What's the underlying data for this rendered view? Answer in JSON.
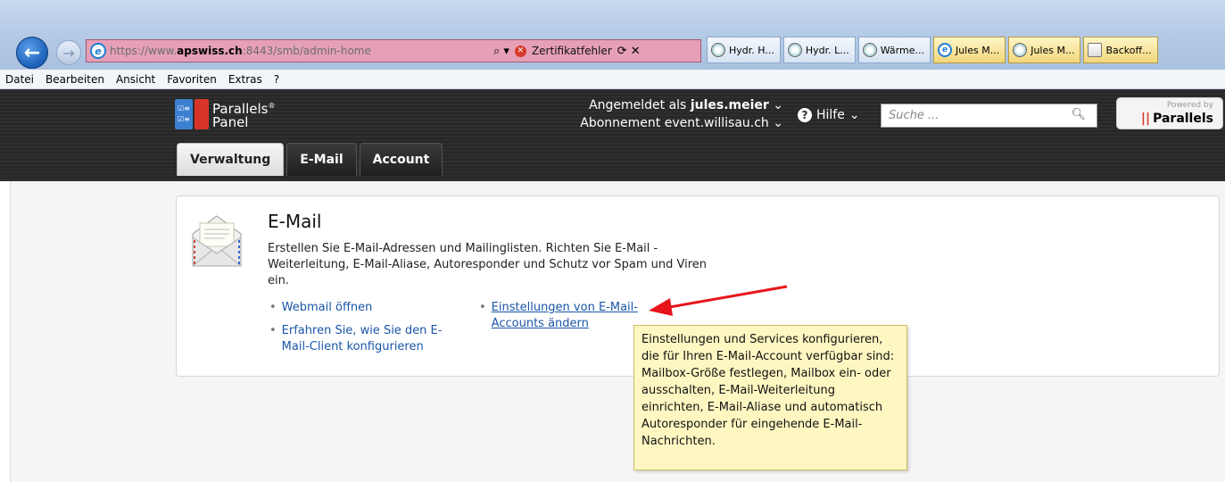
{
  "browser": {
    "url_prefix": "https://www.",
    "url_domain": "apswiss.ch",
    "url_suffix": ":8443/smb/admin-home",
    "search_glyph": "⌕ ▾",
    "cert_error": "Zertifikatfehler",
    "tools_glyph": "⟳ ✕",
    "tabs": [
      {
        "label": "Hydr. H...",
        "icon": "web-icon"
      },
      {
        "label": "Hydr. L...",
        "icon": "web-icon"
      },
      {
        "label": "Wärme...",
        "icon": "web-icon"
      },
      {
        "label": "Jules M...",
        "icon": "ie-icon"
      },
      {
        "label": "Jules M...",
        "icon": "web-icon"
      },
      {
        "label": "Backoff...",
        "icon": "doc-icon"
      }
    ],
    "menu": [
      "Datei",
      "Bearbeiten",
      "Ansicht",
      "Favoriten",
      "Extras",
      "?"
    ]
  },
  "panel": {
    "logo_line1": "Parallels",
    "logo_reg": "®",
    "logo_line2": "Panel",
    "logged_in_label": "Angemeldet als ",
    "user": "jules.meier",
    "subscription_label": "Abonnement ",
    "subscription": "event.willisau.ch",
    "help": "Hilfe",
    "search_placeholder": "Suche ...",
    "powered_by": "Powered by",
    "powered_brand": "Parallels",
    "tabs": [
      "Verwaltung",
      "E-Mail",
      "Account"
    ]
  },
  "email_card": {
    "title": "E-Mail",
    "description": "Erstellen Sie E-Mail-Adressen und Mailinglisten. Richten Sie E-Mail -Weiterleitung, E-Mail-Aliase, Autoresponder und Schutz vor Spam und Viren ein.",
    "link_webmail": "Webmail öffnen",
    "link_client_line1": "Erfahren Sie, wie Sie den E-",
    "link_client_line2": "Mail-Client konfigurieren",
    "link_settings_line1": "Einstellungen von E-Mail-",
    "link_settings_line2": "Accounts ändern",
    "tooltip": "Einstellungen und Services konfigurieren, die für Ihren E-Mail-Account verfügbar sind: Mailbox-Größe festlegen, Mailbox ein- oder ausschalten, E-Mail-Weiterleitung einrichten, E-Mail-Aliase und automatisch Autoresponder für eingehende E-Mail-Nachrichten."
  },
  "colors": {
    "annotation_arrow": "#e8141b",
    "link": "#1a56a8",
    "tooltip_bg": "#fff7c2"
  }
}
